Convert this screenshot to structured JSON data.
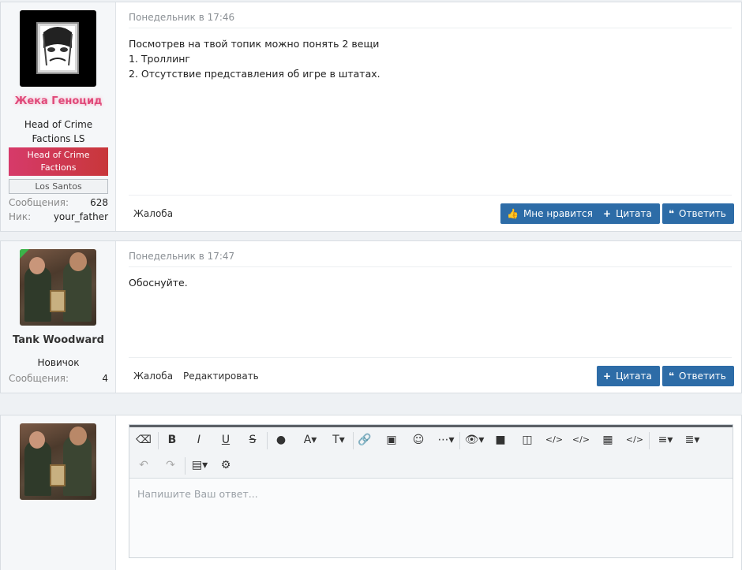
{
  "posts": [
    {
      "username": "Жека Геноцид",
      "title": "Head of Crime Factions LS",
      "banner": "Head of Crime Factions",
      "tag": "Los Santos",
      "stats": [
        {
          "k": "Сообщения:",
          "v": "628"
        },
        {
          "k": "Ник:",
          "v": "your_father"
        }
      ],
      "date": "Понедельник в 17:46",
      "lines": [
        "Посмотрев на твой топик можно понять 2 вещи",
        "1. Троллинг",
        "2. Отсутствие представления об игре в штатах."
      ],
      "report": "Жалоба",
      "like": "Мне нравится",
      "quote": "Цитата",
      "reply": "Ответить"
    },
    {
      "username": "Tank Woodward",
      "title": "Новичок",
      "stats": [
        {
          "k": "Сообщения:",
          "v": "4"
        }
      ],
      "date": "Понедельник в 17:47",
      "lines": [
        "Обоснуйте."
      ],
      "report": "Жалоба",
      "edit": "Редактировать",
      "quote": "Цитата",
      "reply": "Ответить"
    }
  ],
  "editor": {
    "placeholder": "Напишите Ваш ответ..."
  }
}
